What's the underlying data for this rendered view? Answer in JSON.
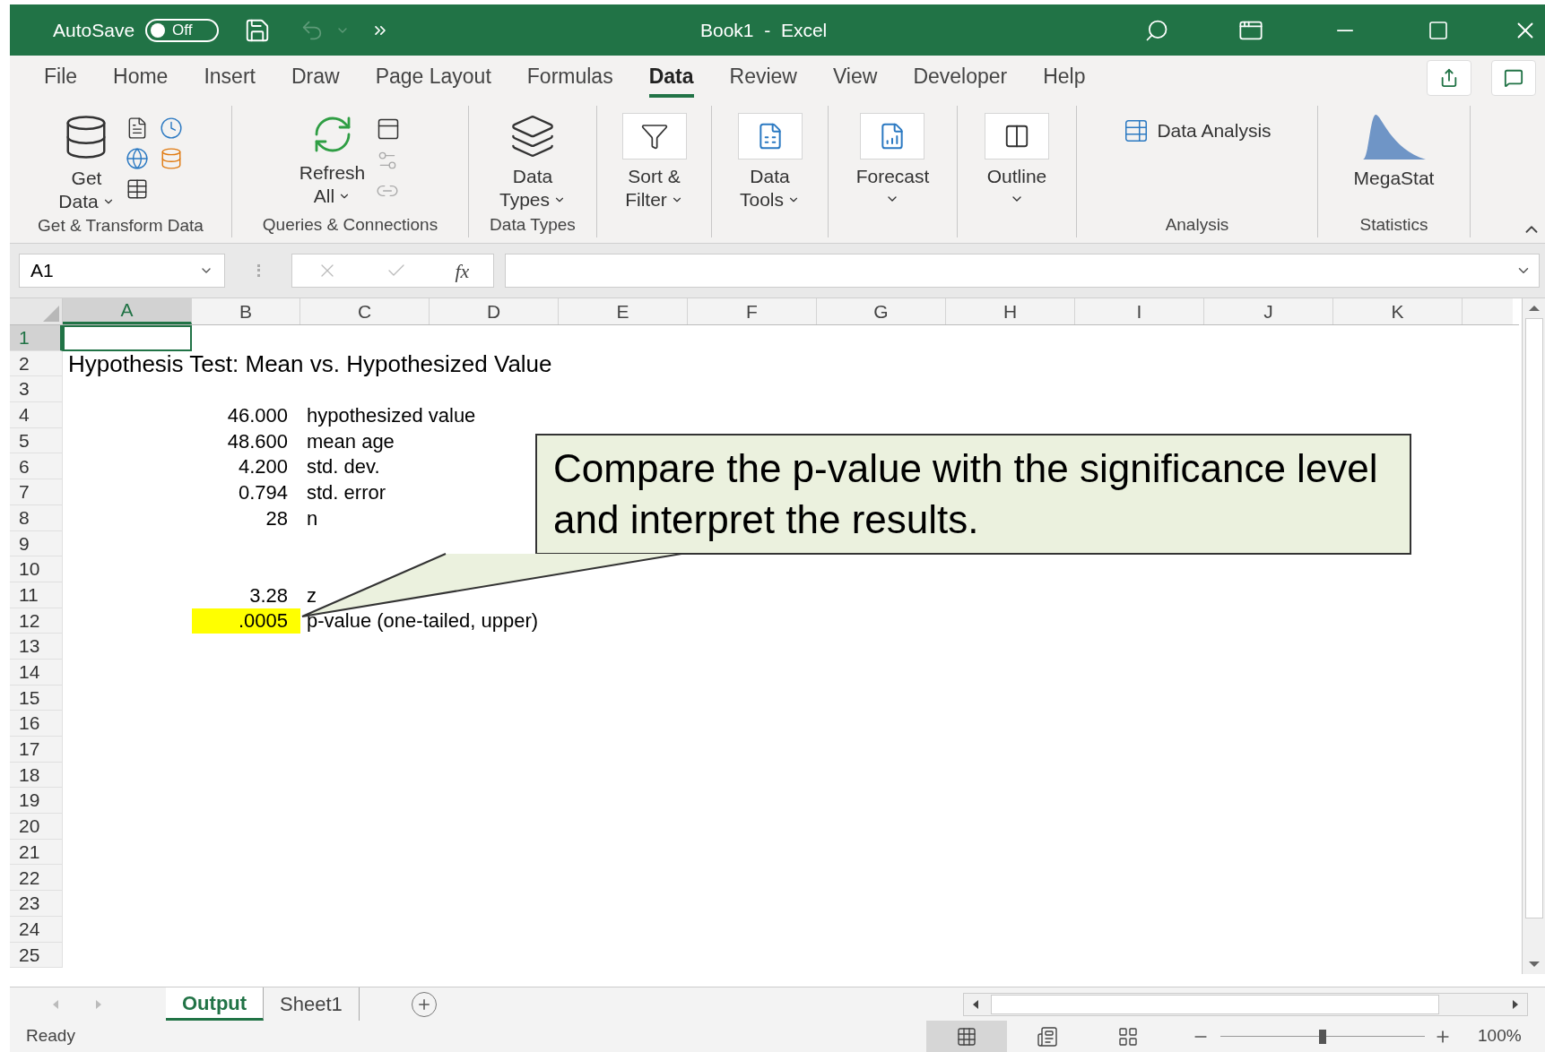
{
  "title_bar": {
    "autosave": {
      "label": "AutoSave",
      "on": false,
      "state_text": "Off"
    },
    "title": "Book1  -  Excel"
  },
  "ribbon_tabs": [
    {
      "label": "File",
      "selected": false
    },
    {
      "label": "Home",
      "selected": false
    },
    {
      "label": "Insert",
      "selected": false
    },
    {
      "label": "Draw",
      "selected": false
    },
    {
      "label": "Page Layout",
      "selected": false
    },
    {
      "label": "Formulas",
      "selected": false
    },
    {
      "label": "Data",
      "selected": true
    },
    {
      "label": "Review",
      "selected": false
    },
    {
      "label": "View",
      "selected": false
    },
    {
      "label": "Developer",
      "selected": false
    },
    {
      "label": "Help",
      "selected": false
    }
  ],
  "ribbon_groups": [
    {
      "kind": "get",
      "label": "Get & Transform Data",
      "buttons": [
        {
          "lines": [
            "Get",
            "Data"
          ],
          "dropdown": true
        }
      ]
    },
    {
      "kind": "queries",
      "label": "Queries & Connections",
      "buttons": [
        {
          "lines": [
            "Refresh",
            "All"
          ],
          "dropdown": true
        }
      ]
    },
    {
      "kind": "types",
      "label": "Data Types",
      "buttons": [
        {
          "lines": [
            "Data",
            "Types"
          ],
          "dropdown": true
        }
      ]
    },
    {
      "kind": "sort",
      "buttons": [
        {
          "lines": [
            "Sort &",
            "Filter"
          ],
          "dropdown": true
        }
      ]
    },
    {
      "kind": "tools",
      "buttons": [
        {
          "lines": [
            "Data",
            "Tools"
          ],
          "dropdown": true
        }
      ]
    },
    {
      "kind": "forecast",
      "buttons": [
        {
          "lines": [
            "Forecast"
          ],
          "dropdown": true
        }
      ]
    },
    {
      "kind": "outline",
      "buttons": [
        {
          "lines": [
            "Outline"
          ],
          "dropdown": true
        }
      ]
    },
    {
      "kind": "analysis",
      "label": "Analysis",
      "buttons": [
        {
          "lines": [
            "Data Analysis"
          ],
          "dropdown": false
        }
      ]
    },
    {
      "kind": "stats",
      "label": "Statistics",
      "buttons": [
        {
          "lines": [
            "MegaStat"
          ],
          "dropdown": false
        }
      ]
    }
  ],
  "formula_bar": {
    "name_box": "A1",
    "function_label": "fx"
  },
  "sheet": {
    "columns": [
      {
        "label": "A",
        "selected": true
      },
      {
        "label": "B",
        "selected": false
      },
      {
        "label": "C",
        "selected": false
      },
      {
        "label": "D",
        "selected": false
      },
      {
        "label": "E",
        "selected": false
      },
      {
        "label": "F",
        "selected": false
      },
      {
        "label": "G",
        "selected": false
      },
      {
        "label": "H",
        "selected": false
      },
      {
        "label": "I",
        "selected": false
      },
      {
        "label": "J",
        "selected": false
      },
      {
        "label": "K",
        "selected": false
      }
    ],
    "rows": [
      {
        "label": "1",
        "selected": true
      },
      {
        "label": "2",
        "selected": false,
        "cells": [
          {
            "value": "Hypothesis Test: Mean vs. Hypothesized Value",
            "kind": "title"
          }
        ]
      },
      {
        "label": "3",
        "selected": false
      },
      {
        "label": "4",
        "selected": false,
        "cells": [
          null,
          {
            "value": "46.000",
            "kind": "number"
          },
          {
            "value": "hypothesized value",
            "kind": "text"
          }
        ]
      },
      {
        "label": "5",
        "selected": false,
        "cells": [
          null,
          {
            "value": "48.600",
            "kind": "number"
          },
          {
            "value": "mean age",
            "kind": "text"
          }
        ]
      },
      {
        "label": "6",
        "selected": false,
        "cells": [
          null,
          {
            "value": "4.200",
            "kind": "number"
          },
          {
            "value": "std. dev.",
            "kind": "text"
          }
        ]
      },
      {
        "label": "7",
        "selected": false,
        "cells": [
          null,
          {
            "value": "0.794",
            "kind": "number"
          },
          {
            "value": "std. error",
            "kind": "text"
          }
        ]
      },
      {
        "label": "8",
        "selected": false,
        "cells": [
          null,
          {
            "value": "28",
            "kind": "number"
          },
          {
            "value": "n",
            "kind": "text"
          }
        ]
      },
      {
        "label": "9",
        "selected": false
      },
      {
        "label": "10",
        "selected": false
      },
      {
        "label": "11",
        "selected": false,
        "cells": [
          null,
          {
            "value": "3.28",
            "kind": "number"
          },
          {
            "value": "z",
            "kind": "text"
          }
        ]
      },
      {
        "label": "12",
        "selected": false,
        "cells": [
          null,
          {
            "value": ".0005",
            "kind": "number",
            "color": "#ffff00"
          },
          {
            "value": "p-value (one-tailed, upper)",
            "kind": "text"
          }
        ]
      },
      {
        "label": "13",
        "selected": false
      },
      {
        "label": "14",
        "selected": false
      },
      {
        "label": "15",
        "selected": false
      },
      {
        "label": "16",
        "selected": false
      },
      {
        "label": "17",
        "selected": false
      },
      {
        "label": "18",
        "selected": false
      },
      {
        "label": "19",
        "selected": false
      },
      {
        "label": "20",
        "selected": false
      },
      {
        "label": "21",
        "selected": false
      },
      {
        "label": "22",
        "selected": false
      },
      {
        "label": "23",
        "selected": false
      },
      {
        "label": "24",
        "selected": false
      },
      {
        "label": "25",
        "selected": false
      }
    ]
  },
  "callout": "Compare the p-value with the significance level and interpret the results.",
  "sheet_tabs": [
    {
      "label": "Output",
      "selected": true
    },
    {
      "label": "Sheet1",
      "selected": false
    }
  ],
  "status_bar": {
    "status": "Ready",
    "views": [
      {
        "kind": "normal",
        "selected": true
      },
      {
        "kind": "page_layout",
        "selected": false
      },
      {
        "kind": "page_break",
        "selected": false
      }
    ],
    "zoom": {
      "level": 0.5,
      "reading": "100%"
    }
  }
}
